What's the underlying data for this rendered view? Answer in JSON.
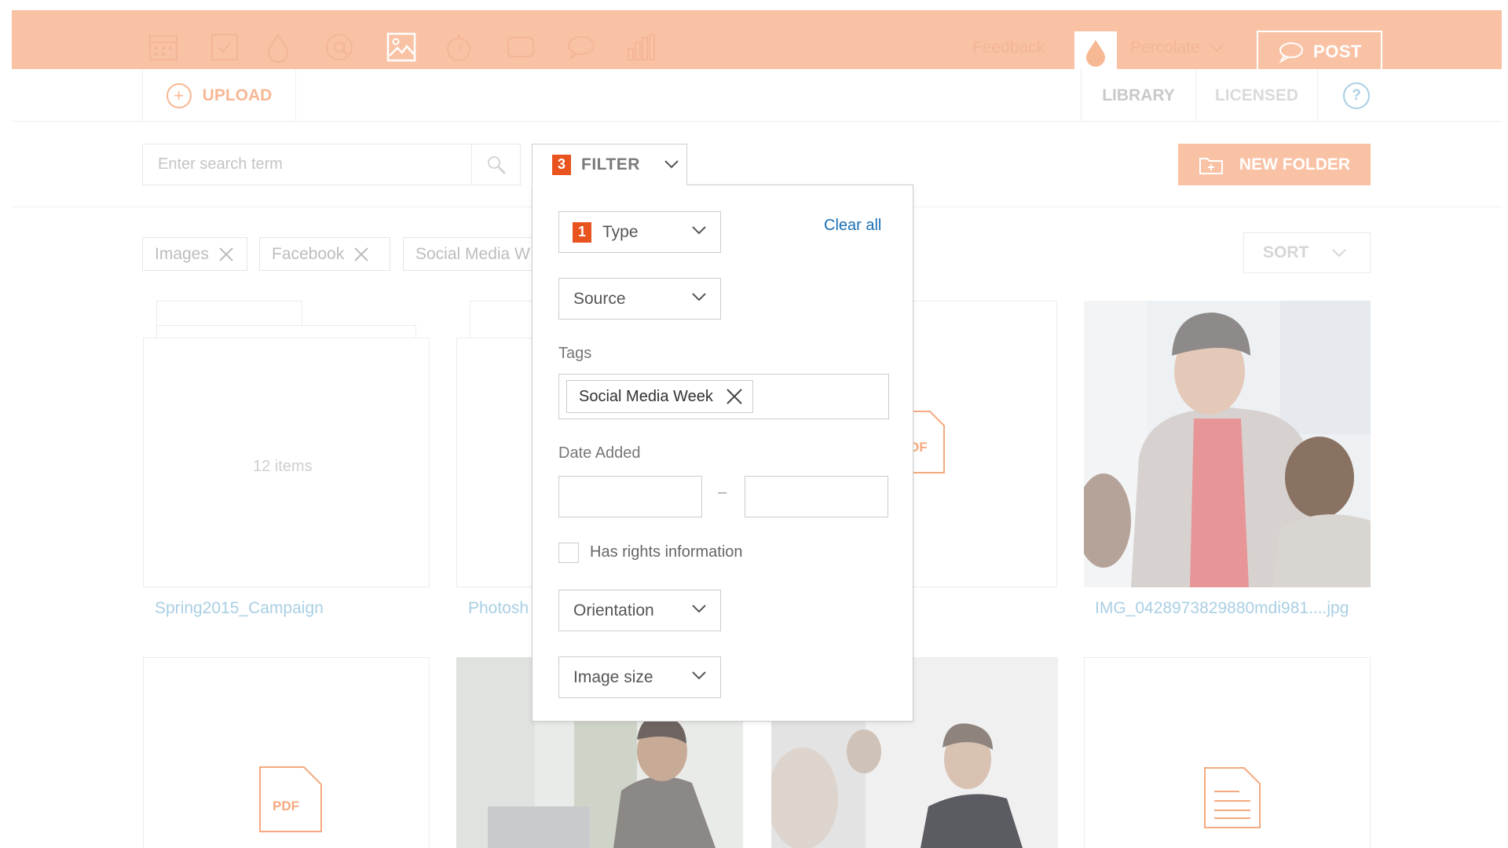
{
  "nav": {
    "icons": [
      "calendar-icon",
      "checklist-icon",
      "drop-icon",
      "at-icon",
      "image-icon",
      "timer-icon",
      "loop-icon",
      "speech-bubble-icon",
      "bar-chart-icon"
    ],
    "active_icon": "image-icon",
    "feedback_label": "Feedback",
    "account_label": "Percolate",
    "post_label": "POST"
  },
  "subbar": {
    "upload_label": "UPLOAD",
    "library_label": "LIBRARY",
    "licensed_label": "LICENSED",
    "help_label": "?"
  },
  "search": {
    "placeholder": "Enter search term",
    "filter_count": "3",
    "filter_label": "FILTER",
    "new_folder_label": "NEW FOLDER"
  },
  "chips": [
    "Images",
    "Facebook",
    "Social Media W"
  ],
  "sort_label": "SORT",
  "grid": {
    "row1": [
      {
        "kind": "folder",
        "count": "12 items",
        "caption": "Spring2015_Campaign"
      },
      {
        "kind": "folder",
        "count": "",
        "caption": "Photosh"
      },
      {
        "kind": "pdf",
        "icon_label": "DF",
        "caption": ""
      },
      {
        "kind": "photo",
        "caption": "IMG_0428973829880mdi981....jpg"
      }
    ],
    "row2": [
      {
        "kind": "pdf",
        "icon_label": "PDF"
      },
      {
        "kind": "photo"
      },
      {
        "kind": "photo"
      },
      {
        "kind": "doc"
      }
    ]
  },
  "filter_panel": {
    "type_count": "1",
    "type_label": "Type",
    "clear_all": "Clear all",
    "source_label": "Source",
    "tags_label": "Tags",
    "tags": [
      "Social Media Week"
    ],
    "date_label": "Date Added",
    "date_separator": "–",
    "rights_label": "Has rights information",
    "orientation_label": "Orientation",
    "image_size_label": "Image size"
  },
  "colors": {
    "accent_faded": "#f9c2a5",
    "badge": "#e8531e",
    "link": "#1a6fb5",
    "link_faded": "#a9cfe3"
  }
}
